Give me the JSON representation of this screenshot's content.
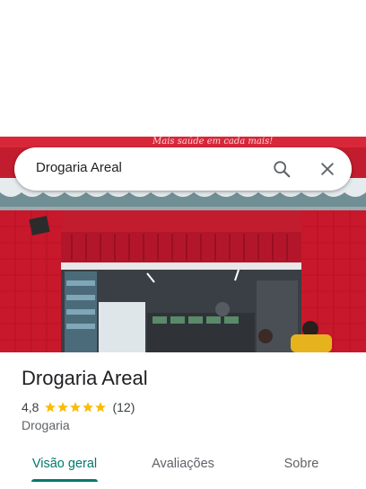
{
  "search": {
    "query": "Drogaria Areal",
    "search_icon": "search-icon",
    "close_icon": "close-icon"
  },
  "photo": {
    "banner_text": "Mais saúde em cada mais!"
  },
  "place": {
    "name": "Drogaria Areal",
    "rating": "4,8",
    "rating_stars": 4.8,
    "review_count": "(12)",
    "category": "Drogaria"
  },
  "tabs": [
    {
      "label": "Visão geral",
      "selected": true
    },
    {
      "label": "Avaliações",
      "selected": false
    },
    {
      "label": "Sobre",
      "selected": false
    }
  ],
  "colors": {
    "accent": "#00796b",
    "star": "#fbbc04",
    "storefront": "#c8102e"
  }
}
